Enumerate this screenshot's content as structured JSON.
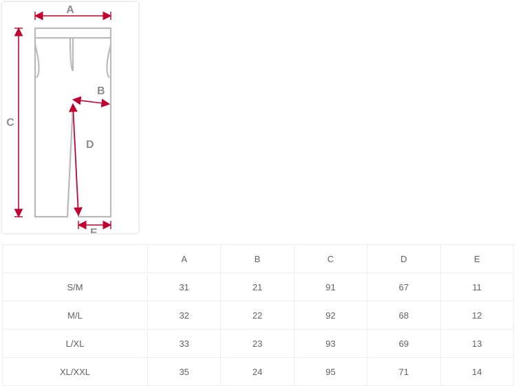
{
  "diagram": {
    "labels": {
      "A": "A",
      "B": "B",
      "C": "C",
      "D": "D",
      "E": "E"
    }
  },
  "chart_data": {
    "type": "table",
    "columns": [
      "A",
      "B",
      "C",
      "D",
      "E"
    ],
    "rows": [
      {
        "size": "S/M",
        "A": 31,
        "B": 21,
        "C": 91,
        "D": 67,
        "E": 11
      },
      {
        "size": "M/L",
        "A": 32,
        "B": 22,
        "C": 92,
        "D": 68,
        "E": 12
      },
      {
        "size": "L/XL",
        "A": 33,
        "B": 23,
        "C": 93,
        "D": 69,
        "E": 13
      },
      {
        "size": "XL/XXL",
        "A": 35,
        "B": 24,
        "C": 95,
        "D": 71,
        "E": 14
      }
    ]
  }
}
